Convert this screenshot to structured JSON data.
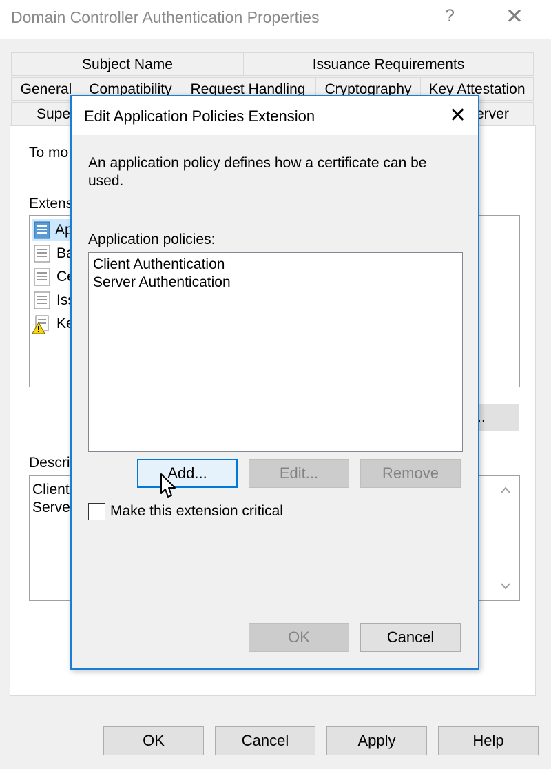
{
  "window": {
    "title": "Domain Controller Authentication Properties",
    "help_glyph": "?",
    "close_glyph": "✕"
  },
  "tabs": {
    "row1": [
      "Subject Name",
      "Issuance Requirements"
    ],
    "row2": [
      "General",
      "Compatibility",
      "Request Handling",
      "Cryptography",
      "Key Attestation"
    ],
    "row3": [
      "Supe",
      "erver"
    ]
  },
  "background": {
    "intro_text": "To mo",
    "extensions_label": "Extens",
    "extension_items": [
      "Ap",
      "Ba",
      "Ce",
      "Iss",
      "Ke"
    ],
    "edit_button_label": "..",
    "description_label": "Descri",
    "description_lines": [
      "Client",
      "Serve"
    ]
  },
  "dialog": {
    "title": "Edit Application Policies Extension",
    "close_glyph": "✕",
    "description": "An application policy defines how a certificate can be used.",
    "policies_label": "Application policies:",
    "policies": [
      "Client Authentication",
      "Server Authentication"
    ],
    "add_label": "Add...",
    "edit_label": "Edit...",
    "remove_label": "Remove",
    "critical_label": "Make this extension critical",
    "ok_label": "OK",
    "cancel_label": "Cancel"
  },
  "footer": {
    "ok_label": "OK",
    "cancel_label": "Cancel",
    "apply_label": "Apply",
    "help_label": "Help"
  },
  "colors": {
    "dialog_border": "#1a7fd4",
    "focus_border": "#0078d7",
    "warning_icon": "#f7d51b"
  }
}
